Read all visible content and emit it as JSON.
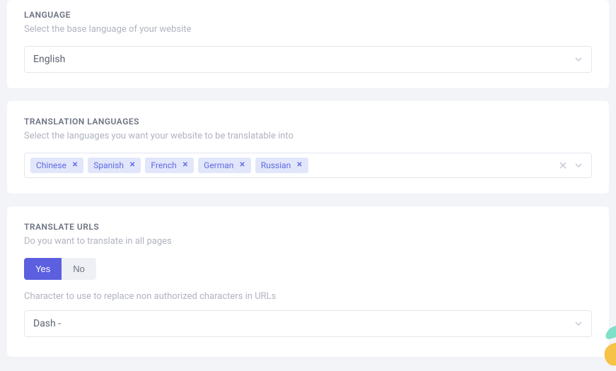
{
  "language": {
    "title": "LANGUAGE",
    "subtitle": "Select the base language of your website",
    "selected": "English"
  },
  "translation": {
    "title": "TRANSLATION LANGUAGES",
    "subtitle": "Select the languages you want your website to be translatable into",
    "tags": [
      "Chinese",
      "Spanish",
      "French",
      "German",
      "Russian"
    ]
  },
  "urls": {
    "title": "TRANSLATE URLS",
    "subtitle": "Do you want to translate in all pages",
    "toggle": {
      "yes": "Yes",
      "no": "No",
      "active": "yes"
    },
    "hint": "Character to use to replace non authorized characters in URLs",
    "selected": "Dash -"
  }
}
